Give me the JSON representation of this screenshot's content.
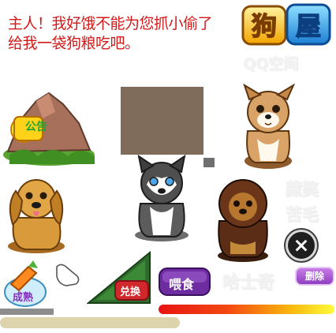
{
  "speech": {
    "line1": "主人！我好饿不能为您抓小偷了",
    "line2": "给我一袋狗粮吃吧。"
  },
  "logo": {
    "title": "狗屋",
    "subtitle": "QQ空间"
  },
  "notice": {
    "label": "公告"
  },
  "labels": {
    "ghost_1": "藏獒",
    "ghost_2": "苦毛",
    "ghost_3": "哈士奇"
  },
  "buttons": {
    "close": "×",
    "delete": "删除",
    "exchange": "兑换",
    "feed": "喂食",
    "harvest": "成熟"
  },
  "colors": {
    "speech": "#d31a1a",
    "panel": "#7f6c5a",
    "delete": "#a450d0"
  },
  "icons": {
    "close": "close-icon",
    "hand": "pointer-hand-icon",
    "harvest": "carrot-basket-icon"
  }
}
